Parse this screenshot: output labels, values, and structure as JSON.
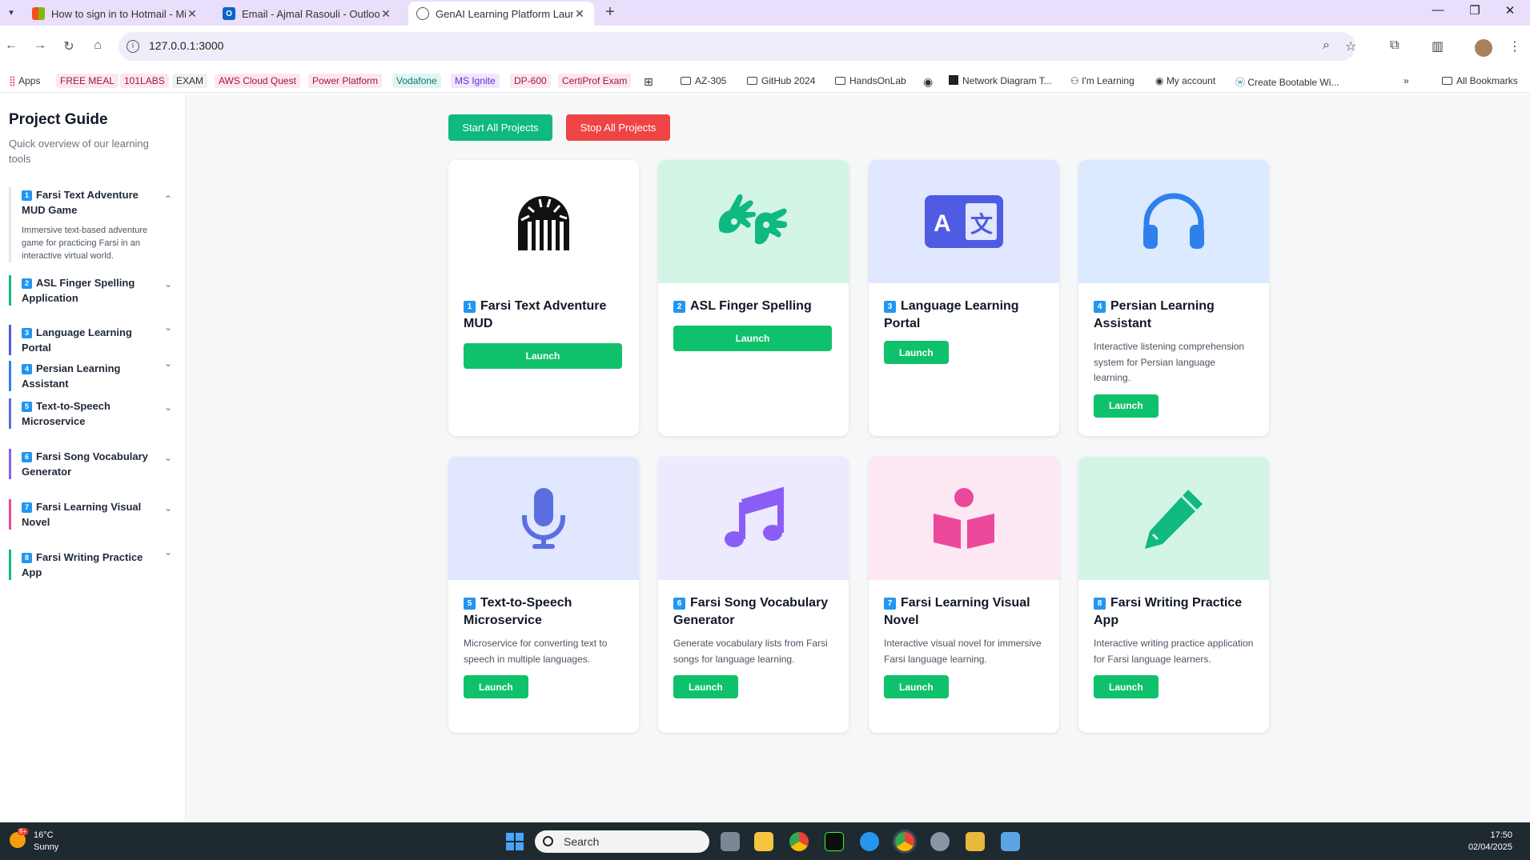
{
  "browser": {
    "tabs": [
      {
        "title": "How to sign in to Hotmail - Mic",
        "close": "✕"
      },
      {
        "title": "Email - Ajmal Rasouli - Outlook",
        "close": "✕"
      },
      {
        "title": "GenAI Learning Platform Launc",
        "close": "✕"
      }
    ],
    "new_tab": "+",
    "url": "127.0.0.1:3000",
    "bookmarks": [
      "Apps",
      "FREE MEAL",
      "101LABS",
      "EXAM",
      "AWS Cloud Quest",
      "Power Platform",
      "Vodafone",
      "MS Ignite",
      "DP-600",
      "CertiProf Exam",
      "AZ-305",
      "GitHub 2024",
      "HandsOnLab",
      "Network Diagram T...",
      "I'm Learning",
      "My account",
      "Create Bootable Wi...",
      "All Bookmarks"
    ]
  },
  "sidebar": {
    "title": "Project Guide",
    "subtitle": "Quick overview of our learning tools",
    "items": [
      {
        "num": "1",
        "label": "Farsi Text Adventure MUD Game",
        "desc": "Immersive text-based adventure game for practicing Farsi in an interactive virtual world.",
        "chev": "⌃"
      },
      {
        "num": "2",
        "label": "ASL Finger Spelling Application",
        "chev": "⌄"
      },
      {
        "num": "3",
        "label": "Language Learning Portal",
        "chev": "⌄"
      },
      {
        "num": "4",
        "label": "Persian Learning Assistant",
        "chev": "⌄"
      },
      {
        "num": "5",
        "label": "Text-to-Speech Microservice",
        "chev": "⌄"
      },
      {
        "num": "6",
        "label": "Farsi Song Vocabulary Generator",
        "chev": "⌄"
      },
      {
        "num": "7",
        "label": "Farsi Learning Visual Novel",
        "chev": "⌄"
      },
      {
        "num": "8",
        "label": "Farsi Writing Practice App",
        "chev": "⌄"
      }
    ]
  },
  "actions": {
    "start_all": "Start All Projects",
    "stop_all": "Stop All Projects"
  },
  "cards": [
    {
      "num": "1",
      "title": "Farsi Text Adventure MUD",
      "desc": "",
      "launch": "Launch",
      "icon": "dungeon-icon",
      "color": "#111111"
    },
    {
      "num": "2",
      "title": "ASL Finger Spelling",
      "desc": "",
      "launch": "Launch",
      "icon": "sign-language-icon",
      "color": "#10b981"
    },
    {
      "num": "3",
      "title": "Language Learning Portal",
      "desc": "",
      "launch": "Launch",
      "icon": "language-icon",
      "color": "#4f5be3"
    },
    {
      "num": "4",
      "title": "Persian Learning Assistant",
      "desc": "Interactive listening comprehension system for Persian language learning.",
      "launch": "Launch",
      "icon": "headphones-icon",
      "color": "#2f80ed"
    },
    {
      "num": "5",
      "title": "Text-to-Speech Microservice",
      "desc": "Microservice for converting text to speech in multiple languages.",
      "launch": "Launch",
      "icon": "microphone-icon",
      "color": "#5b6ee1"
    },
    {
      "num": "6",
      "title": "Farsi Song Vocabulary Generator",
      "desc": "Generate vocabulary lists from Farsi songs for language learning.",
      "launch": "Launch",
      "icon": "music-icon",
      "color": "#8b5cf6"
    },
    {
      "num": "7",
      "title": "Farsi Learning Visual Novel",
      "desc": "Interactive visual novel for immersive Farsi language learning.",
      "launch": "Launch",
      "icon": "book-reader-icon",
      "color": "#ec4899"
    },
    {
      "num": "8",
      "title": "Farsi Writing Practice App",
      "desc": "Interactive writing practice application for Farsi language learners.",
      "launch": "Launch",
      "icon": "pen-icon",
      "color": "#10b981"
    }
  ],
  "taskbar": {
    "temp": "16°C",
    "condition": "Sunny",
    "badge": "9+",
    "search": "Search",
    "time": "17:50",
    "date": "02/04/2025"
  },
  "colors": {
    "accent_green": "#10c16c",
    "stop_red": "#ef4444",
    "number_badge": "#2196f3"
  }
}
